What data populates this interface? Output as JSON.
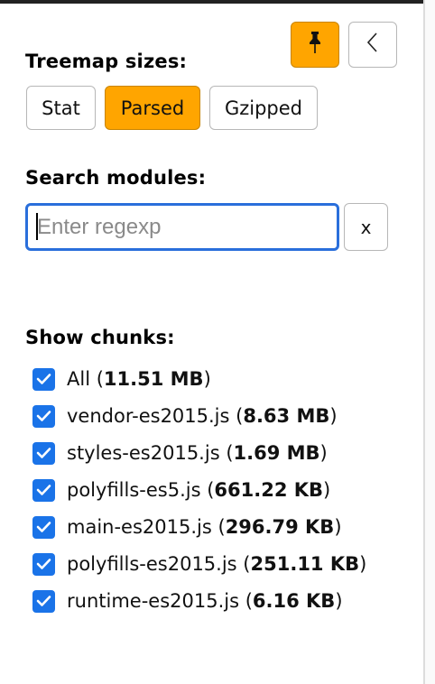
{
  "toolbar": {
    "pin_icon": "pin-icon",
    "collapse_icon": "chevron-left-icon",
    "accent_color": "#ffa500"
  },
  "treemap_sizes": {
    "label": "Treemap sizes:",
    "options": [
      "Stat",
      "Parsed",
      "Gzipped"
    ],
    "selected": "Parsed"
  },
  "search": {
    "label": "Search modules:",
    "placeholder": "Enter regexp",
    "value": "",
    "clear_label": "x"
  },
  "chunks": {
    "label": "Show chunks:",
    "items": [
      {
        "name": "All",
        "size": "11.51 MB",
        "checked": true
      },
      {
        "name": "vendor-es2015.js",
        "size": "8.63 MB",
        "checked": true
      },
      {
        "name": "styles-es2015.js",
        "size": "1.69 MB",
        "checked": true
      },
      {
        "name": "polyfills-es5.js",
        "size": "661.22 KB",
        "checked": true
      },
      {
        "name": "main-es2015.js",
        "size": "296.79 KB",
        "checked": true
      },
      {
        "name": "polyfills-es2015.js",
        "size": "251.11 KB",
        "checked": true
      },
      {
        "name": "runtime-es2015.js",
        "size": "6.16 KB",
        "checked": true
      }
    ]
  }
}
